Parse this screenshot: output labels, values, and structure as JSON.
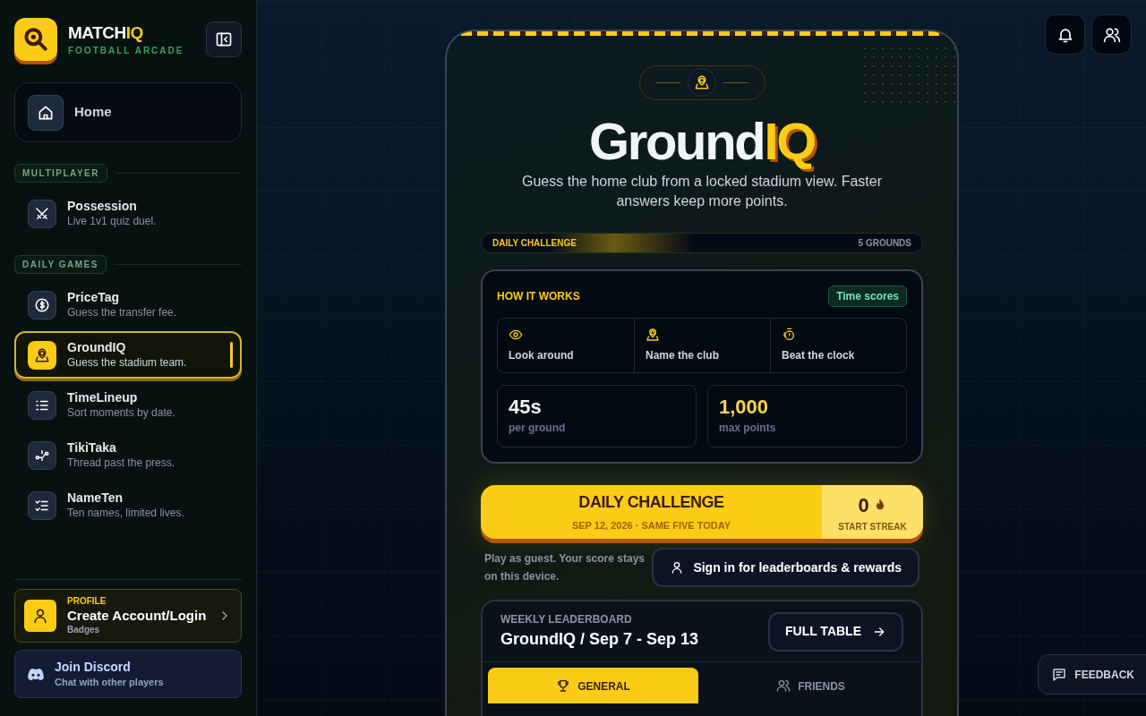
{
  "brand": {
    "name": "MATCH",
    "accent": "IQ",
    "tagline": "FOOTBALL ARCADE"
  },
  "sidebar": {
    "home": {
      "label": "Home",
      "selected": false
    },
    "sections": [
      {
        "heading": "MULTIPLAYER",
        "items": [
          {
            "title": "Possession",
            "subtitle": "Live 1v1 quiz duel.",
            "selected": false
          }
        ]
      },
      {
        "heading": "DAILY GAMES",
        "items": [
          {
            "title": "PriceTag",
            "subtitle": "Guess the transfer fee.",
            "selected": false
          },
          {
            "title": "GroundIQ",
            "subtitle": "Guess the stadium team.",
            "selected": true
          },
          {
            "title": "TimeLineup",
            "subtitle": "Sort moments by date.",
            "selected": false
          },
          {
            "title": "TikiTaka",
            "subtitle": "Thread past the press.",
            "selected": false
          },
          {
            "title": "NameTen",
            "subtitle": "Ten names, limited lives.",
            "selected": false
          }
        ]
      }
    ],
    "profile": {
      "eyebrow": "PROFILE",
      "title": "Create Account/Login",
      "subtitle": "Badges"
    },
    "discord": {
      "title": "Join Discord",
      "subtitle": "Chat with other players"
    }
  },
  "game": {
    "title": "Ground",
    "accent": "IQ",
    "description": "Guess the home club from a locked stadium view. Faster answers keep more points.",
    "challenge_bar": {
      "label": "DAILY CHALLENGE",
      "count": "5 GROUNDS"
    },
    "how_it_works": {
      "heading": "HOW IT WORKS",
      "badge": "Time scores",
      "steps": [
        "Look around",
        "Name the club",
        "Beat the clock"
      ],
      "stats": [
        {
          "value": "45s",
          "label": "per ground",
          "highlight": false
        },
        {
          "value": "1,000",
          "label": "max points",
          "highlight": true
        }
      ]
    },
    "daily": {
      "title": "DAILY CHALLENGE",
      "date": "SEP 12, 2026 · SAME FIVE TODAY",
      "streak": "0",
      "streak_label": "START STREAK"
    },
    "guest_note": "Play as guest. Your score stays on this device.",
    "sign_in": "Sign in for leaderboards & rewards",
    "leaderboard": {
      "eyebrow": "WEEKLY LEADERBOARD",
      "title": "GroundIQ / Sep 7 - Sep 13",
      "button": "FULL TABLE",
      "tabs": [
        {
          "label": "GENERAL",
          "selected": true
        },
        {
          "label": "FRIENDS",
          "selected": false
        }
      ]
    }
  },
  "feedback": "FEEDBACK"
}
